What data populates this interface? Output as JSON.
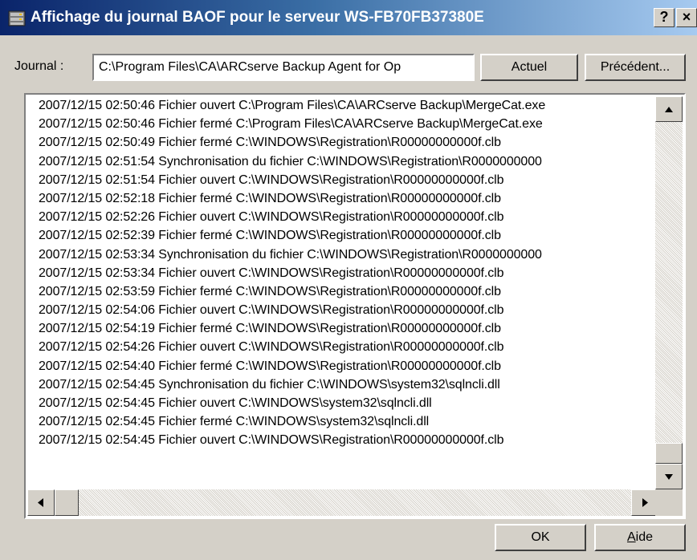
{
  "window": {
    "title": "Affichage du journal BAOF pour le serveur WS-FB70FB37380E",
    "help_button": "?",
    "close_button": "×"
  },
  "journal": {
    "label": "Journal :",
    "value": "C:\\Program Files\\CA\\ARCserve Backup Agent for Op",
    "current_button": "Actuel",
    "previous_button": "Précédent..."
  },
  "log_lines": [
    "2007/12/15 02:50:46 Fichier ouvert C:\\Program Files\\CA\\ARCserve Backup\\MergeCat.exe",
    "2007/12/15 02:50:46 Fichier fermé C:\\Program Files\\CA\\ARCserve Backup\\MergeCat.exe",
    "2007/12/15 02:50:49 Fichier fermé C:\\WINDOWS\\Registration\\R00000000000f.clb",
    "2007/12/15 02:51:54 Synchronisation du fichier C:\\WINDOWS\\Registration\\R0000000000",
    "2007/12/15 02:51:54 Fichier ouvert C:\\WINDOWS\\Registration\\R00000000000f.clb",
    "2007/12/15 02:52:18 Fichier fermé C:\\WINDOWS\\Registration\\R00000000000f.clb",
    "2007/12/15 02:52:26 Fichier ouvert C:\\WINDOWS\\Registration\\R00000000000f.clb",
    "2007/12/15 02:52:39 Fichier fermé C:\\WINDOWS\\Registration\\R00000000000f.clb",
    "2007/12/15 02:53:34 Synchronisation du fichier C:\\WINDOWS\\Registration\\R0000000000",
    "2007/12/15 02:53:34 Fichier ouvert C:\\WINDOWS\\Registration\\R00000000000f.clb",
    "2007/12/15 02:53:59 Fichier fermé C:\\WINDOWS\\Registration\\R00000000000f.clb",
    "2007/12/15 02:54:06 Fichier ouvert C:\\WINDOWS\\Registration\\R00000000000f.clb",
    "2007/12/15 02:54:19 Fichier fermé C:\\WINDOWS\\Registration\\R00000000000f.clb",
    "2007/12/15 02:54:26 Fichier ouvert C:\\WINDOWS\\Registration\\R00000000000f.clb",
    "2007/12/15 02:54:40 Fichier fermé C:\\WINDOWS\\Registration\\R00000000000f.clb",
    "2007/12/15 02:54:45 Synchronisation du fichier C:\\WINDOWS\\system32\\sqlncli.dll",
    "2007/12/15 02:54:45 Fichier ouvert C:\\WINDOWS\\system32\\sqlncli.dll",
    "2007/12/15 02:54:45 Fichier fermé C:\\WINDOWS\\system32\\sqlncli.dll",
    "2007/12/15 02:54:45 Fichier ouvert C:\\WINDOWS\\Registration\\R00000000000f.clb"
  ],
  "footer": {
    "ok_button": "OK",
    "help_button_rest": "ide",
    "help_button_mnemonic": "A"
  },
  "icons": {
    "app": "server-log-icon",
    "scroll_up": "arrow-up-icon",
    "scroll_down": "arrow-down-icon",
    "scroll_left": "arrow-left-icon",
    "scroll_right": "arrow-right-icon"
  },
  "colors": {
    "titlebar_start": "#0a246a",
    "titlebar_end": "#a6caf0",
    "face": "#d4d0c8"
  }
}
